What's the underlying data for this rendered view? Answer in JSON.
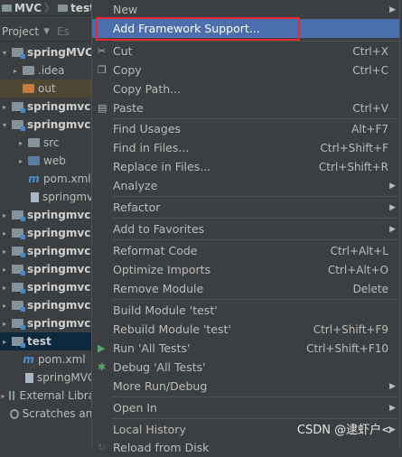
{
  "topbar": {
    "title_left": "MVC",
    "title_right": "test"
  },
  "project_header": {
    "label": "Project",
    "trail": "Es"
  },
  "tree": [
    {
      "label": "springMVC",
      "bold": true,
      "arrow": "▾",
      "icon": "module"
    },
    {
      "label": ".idea",
      "bold": false,
      "arrow": "▸",
      "icon": "folder"
    },
    {
      "label": "out",
      "bold": false,
      "arrow": "",
      "icon": "folder-orange"
    },
    {
      "label": "springmvc-",
      "bold": true,
      "arrow": "▸",
      "icon": "module"
    },
    {
      "label": "springmvc-",
      "bold": true,
      "arrow": "▾",
      "icon": "module"
    },
    {
      "label": "src",
      "bold": false,
      "arrow": "▸",
      "icon": "folder"
    },
    {
      "label": "web",
      "bold": false,
      "arrow": "▸",
      "icon": "folder-blue"
    },
    {
      "label": "pom.xml",
      "bold": false,
      "arrow": "",
      "icon": "m"
    },
    {
      "label": "springmv",
      "bold": false,
      "arrow": "",
      "icon": "file"
    },
    {
      "label": "springmvc-",
      "bold": true,
      "arrow": "▸",
      "icon": "module"
    },
    {
      "label": "springmvc-",
      "bold": true,
      "arrow": "▸",
      "icon": "module"
    },
    {
      "label": "springmvc-",
      "bold": true,
      "arrow": "▸",
      "icon": "module"
    },
    {
      "label": "springmvc-",
      "bold": true,
      "arrow": "▸",
      "icon": "module"
    },
    {
      "label": "springmvc-",
      "bold": true,
      "arrow": "▸",
      "icon": "module"
    },
    {
      "label": "springmvc-",
      "bold": true,
      "arrow": "▸",
      "icon": "module"
    },
    {
      "label": "springmvc-",
      "bold": true,
      "arrow": "▸",
      "icon": "module"
    },
    {
      "label": "test",
      "bold": true,
      "arrow": "▸",
      "icon": "module"
    },
    {
      "label": "pom.xml",
      "bold": false,
      "arrow": "",
      "icon": "m"
    },
    {
      "label": "springMVC.",
      "bold": false,
      "arrow": "",
      "icon": "file"
    },
    {
      "label": "External Librar",
      "bold": false,
      "arrow": "▸",
      "icon": "bars"
    },
    {
      "label": "Scratches and",
      "bold": false,
      "arrow": "",
      "icon": "scratch"
    }
  ],
  "menu": {
    "new": "New",
    "add_framework": "Add Framework Support...",
    "cut": "Cut",
    "cut_sc": "Ctrl+X",
    "copy": "Copy",
    "copy_sc": "Ctrl+C",
    "copy_path": "Copy Path...",
    "paste": "Paste",
    "paste_sc": "Ctrl+V",
    "find_usages": "Find Usages",
    "find_usages_sc": "Alt+F7",
    "find_in_files": "Find in Files...",
    "find_in_files_sc": "Ctrl+Shift+F",
    "replace_in_files": "Replace in Files...",
    "replace_in_files_sc": "Ctrl+Shift+R",
    "analyze": "Analyze",
    "refactor": "Refactor",
    "add_favorites": "Add to Favorites",
    "reformat": "Reformat Code",
    "reformat_sc": "Ctrl+Alt+L",
    "optimize": "Optimize Imports",
    "optimize_sc": "Ctrl+Alt+O",
    "remove_module": "Remove Module",
    "remove_module_sc": "Delete",
    "build_module": "Build Module 'test'",
    "rebuild_module": "Rebuild Module 'test'",
    "rebuild_module_sc": "Ctrl+Shift+F9",
    "run_tests": "Run 'All Tests'",
    "run_tests_sc": "Ctrl+Shift+F10",
    "debug_tests": "Debug 'All Tests'",
    "more_run": "More Run/Debug",
    "open_in": "Open In",
    "local_history": "Local History",
    "reload": "Reload from Disk"
  },
  "watermark": "CSDN @逮虾户<"
}
